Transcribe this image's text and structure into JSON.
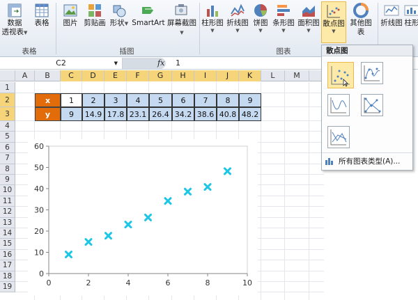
{
  "ribbon": {
    "buttons": [
      {
        "label": "数据",
        "label2": "透视表"
      },
      {
        "label": "表格"
      },
      {
        "label": "图片"
      },
      {
        "label": "剪贴画"
      },
      {
        "label": "形状"
      },
      {
        "label": "SmartArt"
      },
      {
        "label": "屏幕截图"
      },
      {
        "label": "柱形图"
      },
      {
        "label": "折线图"
      },
      {
        "label": "饼图"
      },
      {
        "label": "条形图"
      },
      {
        "label": "面积图"
      },
      {
        "label": "散点图"
      },
      {
        "label": "其他图表"
      },
      {
        "label": "折线图"
      },
      {
        "label": "柱形"
      }
    ],
    "groups": [
      "表格",
      "插图",
      "图表"
    ]
  },
  "formula_bar": {
    "name_box": "C2",
    "fx": "fx",
    "value": "1"
  },
  "columns": [
    "A",
    "B",
    "C",
    "D",
    "E",
    "F",
    "G",
    "H",
    "I",
    "J",
    "K",
    "L",
    "M"
  ],
  "rows": [
    "1",
    "2",
    "3",
    "4",
    "5",
    "6",
    "7",
    "8",
    "9",
    "10",
    "11",
    "12",
    "13",
    "14",
    "15",
    "16",
    "17",
    "18",
    "19"
  ],
  "table": {
    "x_label": "x",
    "y_label": "y",
    "x": [
      "1",
      "2",
      "3",
      "4",
      "5",
      "6",
      "7",
      "8",
      "9"
    ],
    "y": [
      "9",
      "14.9",
      "17.8",
      "23.1",
      "26.4",
      "34.2",
      "38.6",
      "40.8",
      "48.2"
    ]
  },
  "chart_data": {
    "type": "scatter",
    "x": [
      1,
      2,
      3,
      4,
      5,
      6,
      7,
      8,
      9
    ],
    "y": [
      9,
      14.9,
      17.8,
      23.1,
      26.4,
      34.2,
      38.6,
      40.8,
      48.2
    ],
    "xlim": [
      0,
      10
    ],
    "ylim": [
      0,
      60
    ],
    "x_ticks": [
      "0",
      "2",
      "4",
      "6",
      "8",
      "10"
    ],
    "y_ticks": [
      "0",
      "10",
      "20",
      "30",
      "40",
      "50",
      "60"
    ],
    "marker_color": "#1ec6e6",
    "grid": false
  },
  "dropdown": {
    "title": "散点图",
    "all_chart_types": "所有图表类型(A)..."
  },
  "colors": {
    "header_orange": "#e26b0a",
    "cell_blue": "#c5d9f1",
    "selected_header": "#f6d47a"
  }
}
